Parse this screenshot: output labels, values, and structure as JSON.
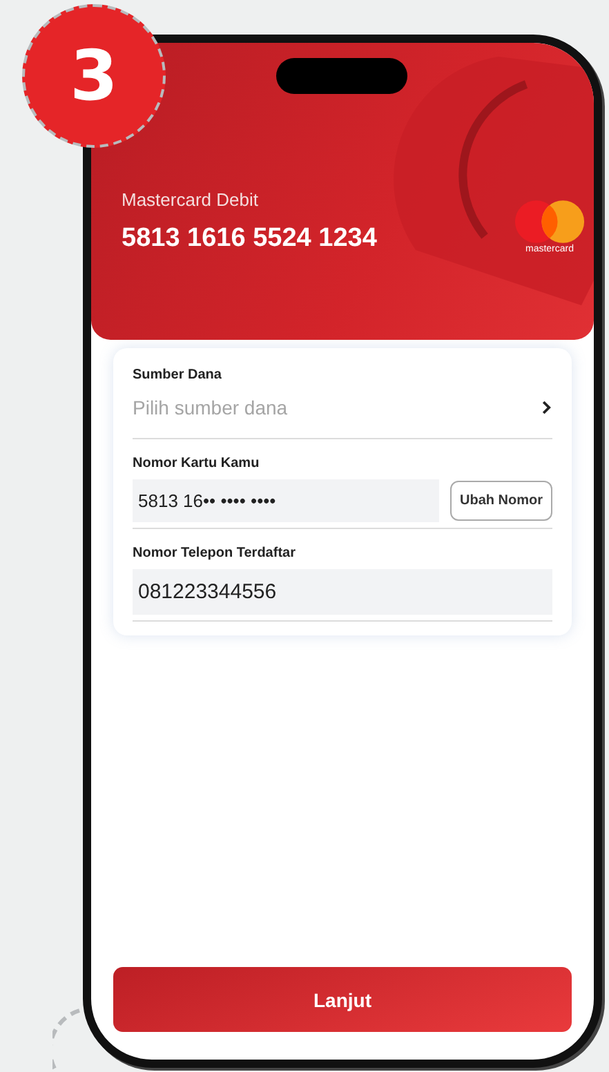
{
  "step_badge": "3",
  "card": {
    "type": "Mastercard Debit",
    "number": "5813 1616 5524 1234",
    "brand": "mastercard"
  },
  "form": {
    "fields": [
      {
        "kind": "select",
        "label": "Sumber Dana",
        "placeholder": "Pilih sumber dana"
      },
      {
        "kind": "input_button",
        "label": "Nomor Kartu Kamu",
        "value": "5813 16•• •••• ••••",
        "button": "Ubah Nomor"
      },
      {
        "kind": "input",
        "label": "Nomor Telepon Terdaftar",
        "value": "081223344556"
      }
    ]
  },
  "primary_button": "Lanjut"
}
